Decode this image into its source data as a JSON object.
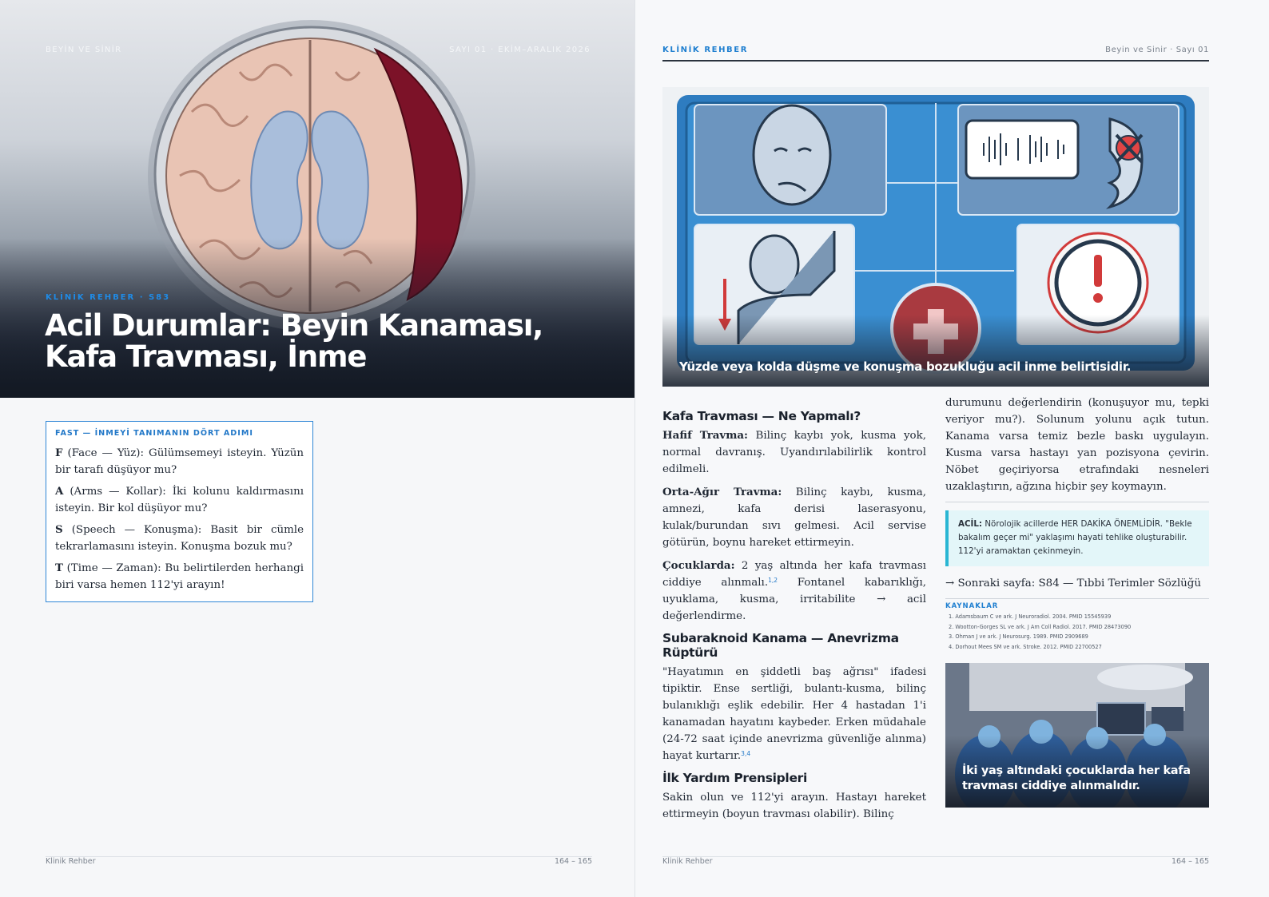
{
  "left_page": {
    "running_left": "BEYİN VE SİNİR",
    "running_right": "SAYI 01 · EKİM–ARALIK 2026",
    "kicker": "KLİNİK REHBER · S83",
    "title": "Acil Durumlar: Beyin Kanaması, Kafa Travması, İnme",
    "fast_box": {
      "heading": "FAST — İNMEYİ TANIMANIN DÖRT ADIMI",
      "items": [
        {
          "letter": "F",
          "text": " (Face — Yüz): Gülümsemeyi isteyin. Yüzün bir tarafı düşüyor mu?"
        },
        {
          "letter": "A",
          "text": " (Arms — Kollar): İki kolunu kaldırmasını isteyin. Bir kol düşüyor mu?"
        },
        {
          "letter": "S",
          "text": " (Speech — Konuşma): Basit bir cümle tekrarlamasını isteyin. Konuşma bozuk mu?"
        },
        {
          "letter": "T",
          "text": " (Time — Zaman): Bu belirtilerden herhangi biri varsa hemen 112'yi arayın!"
        }
      ]
    },
    "footer_left": "Klinik Rehber",
    "footer_right": "164 – 165"
  },
  "right_page": {
    "running_left": "KLİNİK REHBER",
    "running_right": "Beyin ve Sinir · Sayı 01",
    "figure1_caption": "Yüzde veya kolda düşme ve konuşma bozukluğu acil inme belirtisidir.",
    "section1_title": "Kafa Travması — Ne Yapmalı?",
    "p1_label": "Hafif Travma:",
    "p1_text": " Bilinç kaybı yok, kusma yok, normal davranış. Uyandırılabilirlik kontrol edilmeli.",
    "p2_label": "Orta-Ağır Travma:",
    "p2_text": " Bilinç kaybı, kusma, amnezi, kafa derisi laserasyonu, kulak/burundan sıvı gelmesi. Acil servise götürün, boynu hareket ettirmeyin.",
    "p3_label": "Çocuklarda:",
    "p3_text_a": " 2 yaş altında her kafa travması ciddiye alınmalı.",
    "p3_sup": "1,2",
    "p3_text_b": " Fontanel kabarıklığı, uyuklama, kusma, irritabilite → acil değerlendirme.",
    "section2_title": "Subaraknoid Kanama — Anevrizma Rüptürü",
    "p4_text": "\"Hayatımın en şiddetli baş ağrısı\" ifadesi tipiktir. Ense sertliği, bulantı-kusma, bilinç bulanıklığı eşlik edebilir. Her 4 hastadan 1'i kanamadan hayatını kaybeder. Erken müdahale (24-72 saat içinde anevrizma güvenliğe alınma) hayat kurtarır.",
    "p4_sup": "3,4",
    "section3_title": "İlk Yardım Prensipleri",
    "p5_text": "Sakin olun ve 112'yi arayın. Hastayı hareket ettirmeyin (boyun travması olabilir). Bilinç",
    "p6_text": "durumunu değerlendirin (konuşuyor mu, tepki veriyor mu?). Solunum yolunu açık tutun. Kanama varsa temiz bezle baskı uygulayın. Kusma varsa hastayı yan pozisyona çevirin. Nöbet geçiriyorsa etrafındaki nesneleri uzaklaştırın, ağzına hiçbir şey koymayın.",
    "alert_label": "ACİL:",
    "alert_text": " Nörolojik acillerde HER DAKİKA ÖNEMLİDİR. \"Bekle bakalım geçer mi\" yaklaşımı hayati tehlike oluşturabilir. 112'yi aramaktan çekinmeyin.",
    "next_page": "→ Sonraki sayfa: S84 — Tıbbi Terimler Sözlüğü",
    "refs_heading": "KAYNAKLAR",
    "refs": [
      "1. Adamsbaum C ve ark. J Neuroradiol. 2004. PMID 15545939",
      "2. Wootton-Gorges SL ve ark. J Am Coll Radiol. 2017. PMID 28473090",
      "3. Ohman J ve ark. J Neurosurg. 1989. PMID 2909689",
      "4. Dorhout Mees SM ve ark. Stroke. 2012. PMID 22700527"
    ],
    "figure2_caption": "İki yaş altındaki çocuklarda her kafa travması ciddiye alınmalıdır.",
    "footer_left": "Klinik Rehber",
    "footer_right": "164 – 165"
  },
  "colors": {
    "accent_blue": "#1f7fd0",
    "hemorrhage": "#7c1228",
    "alert_bg": "#e3f6f9",
    "alert_border": "#2ab6d3"
  }
}
